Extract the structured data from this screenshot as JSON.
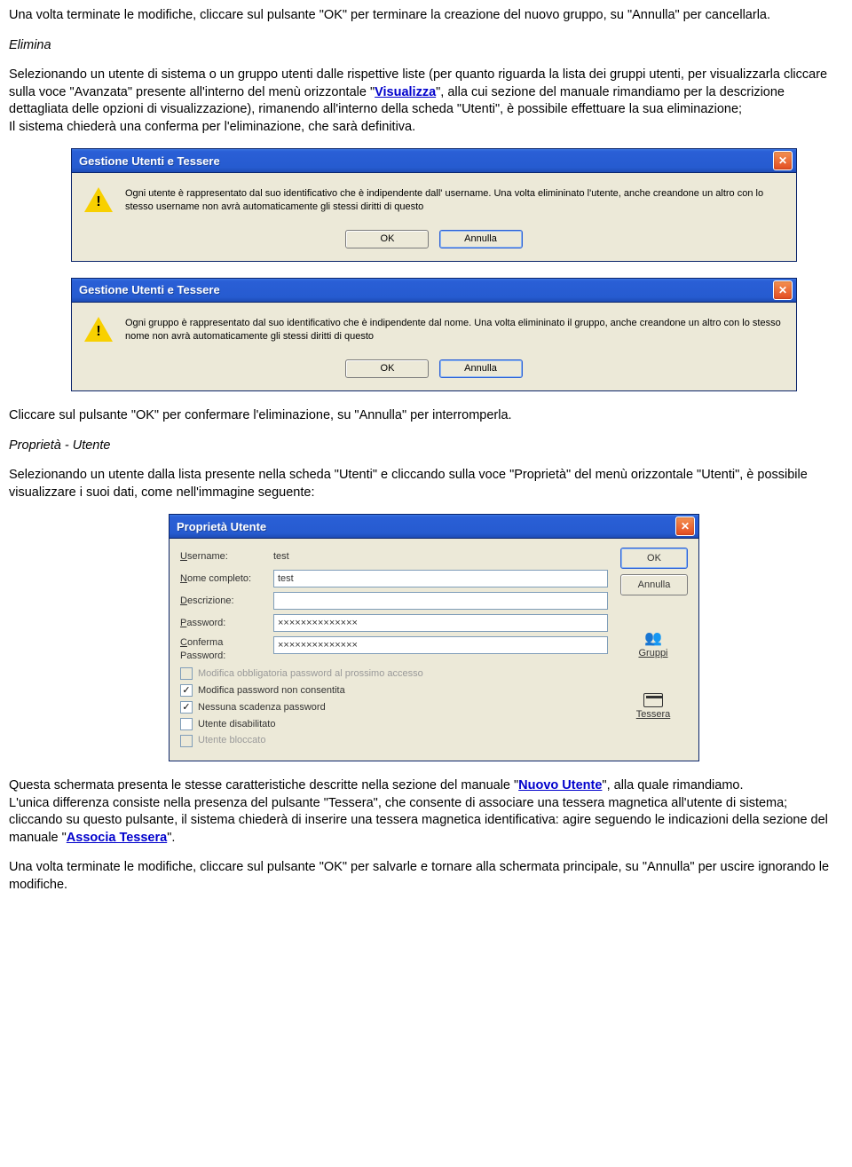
{
  "para1": "Una volta terminate le modifiche, cliccare sul pulsante \"OK\" per terminare la creazione del nuovo gruppo, su \"Annulla\" per cancellarla.",
  "heading_elimina": "Elimina",
  "para2_a": "Selezionando un utente di sistema o un gruppo utenti dalle rispettive liste (per quanto riguarda la lista dei gruppi utenti, per visualizzarla cliccare sulla voce \"Avanzata\" presente all'interno del menù orizzontale \"",
  "para2_link": "Visualizza",
  "para2_b": "\", alla cui sezione del manuale rimandiamo per la descrizione dettagliata delle opzioni di visualizzazione), rimanendo all'interno della scheda \"Utenti\", è possibile effettuare la sua eliminazione;",
  "para2_c": "Il sistema chiederà una conferma per l'eliminazione, che sarà definitiva.",
  "dialog1": {
    "title": "Gestione Utenti e Tessere",
    "message": "Ogni utente è rappresentato dal suo identificativo che è indipendente dall' username. Una volta elimininato l'utente, anche creandone un altro con lo stesso username non avrà automaticamente gli stessi diritti di questo",
    "ok": "OK",
    "cancel": "Annulla"
  },
  "dialog2": {
    "title": "Gestione Utenti e Tessere",
    "message": "Ogni gruppo è rappresentato dal suo identificativo che è indipendente dal nome. Una volta elimininato il gruppo, anche creandone un altro con lo stesso nome non avrà automaticamente gli stessi diritti di questo",
    "ok": "OK",
    "cancel": "Annulla"
  },
  "para3": "Cliccare sul pulsante \"OK\" per confermare l'eliminazione, su \"Annulla\" per interromperla.",
  "heading_proprieta": "Proprietà - Utente",
  "para4": "Selezionando un utente dalla lista presente nella scheda \"Utenti\" e cliccando sulla voce \"Proprietà\" del menù orizzontale \"Utenti\", è possibile visualizzare i suoi dati, come nell'immagine seguente:",
  "prop": {
    "title": "Proprietà Utente",
    "fields": {
      "username_lbl": "Username:",
      "username_val": "test",
      "nome_lbl": "Nome completo:",
      "nome_val": "test",
      "descr_lbl": "Descrizione:",
      "descr_val": "",
      "pwd_lbl": "Password:",
      "pwd_val": "××××××××××××××",
      "conf_lbl1": "Conferma",
      "conf_lbl2": "Password:",
      "conf_val": "××××××××××××××"
    },
    "checks": {
      "c1": "Modifica obbligatoria password al prossimo accesso",
      "c2": "Modifica password non consentita",
      "c3": "Nessuna scadenza password",
      "c4": "Utente disabilitato",
      "c5": "Utente bloccato"
    },
    "btns": {
      "ok": "OK",
      "cancel": "Annulla",
      "gruppi": "Gruppi",
      "tessera": "Tessera"
    }
  },
  "para5_a": "Questa schermata presenta le stesse caratteristiche descritte nella sezione del manuale \"",
  "para5_link": "Nuovo Utente",
  "para5_b": "\", alla quale rimandiamo.",
  "para6_a": "L'unica differenza consiste nella presenza del pulsante \"Tessera\", che consente di associare una tessera magnetica all'utente di sistema; cliccando su questo pulsante, il sistema chiederà di inserire una tessera magnetica identificativa: agire seguendo le indicazioni della sezione del manuale \"",
  "para6_link": "Associa Tessera",
  "para6_b": "\".",
  "para7": "Una volta terminate le modifiche, cliccare sul pulsante \"OK\" per salvarle e tornare alla schermata principale, su \"Annulla\" per uscire ignorando le modifiche."
}
